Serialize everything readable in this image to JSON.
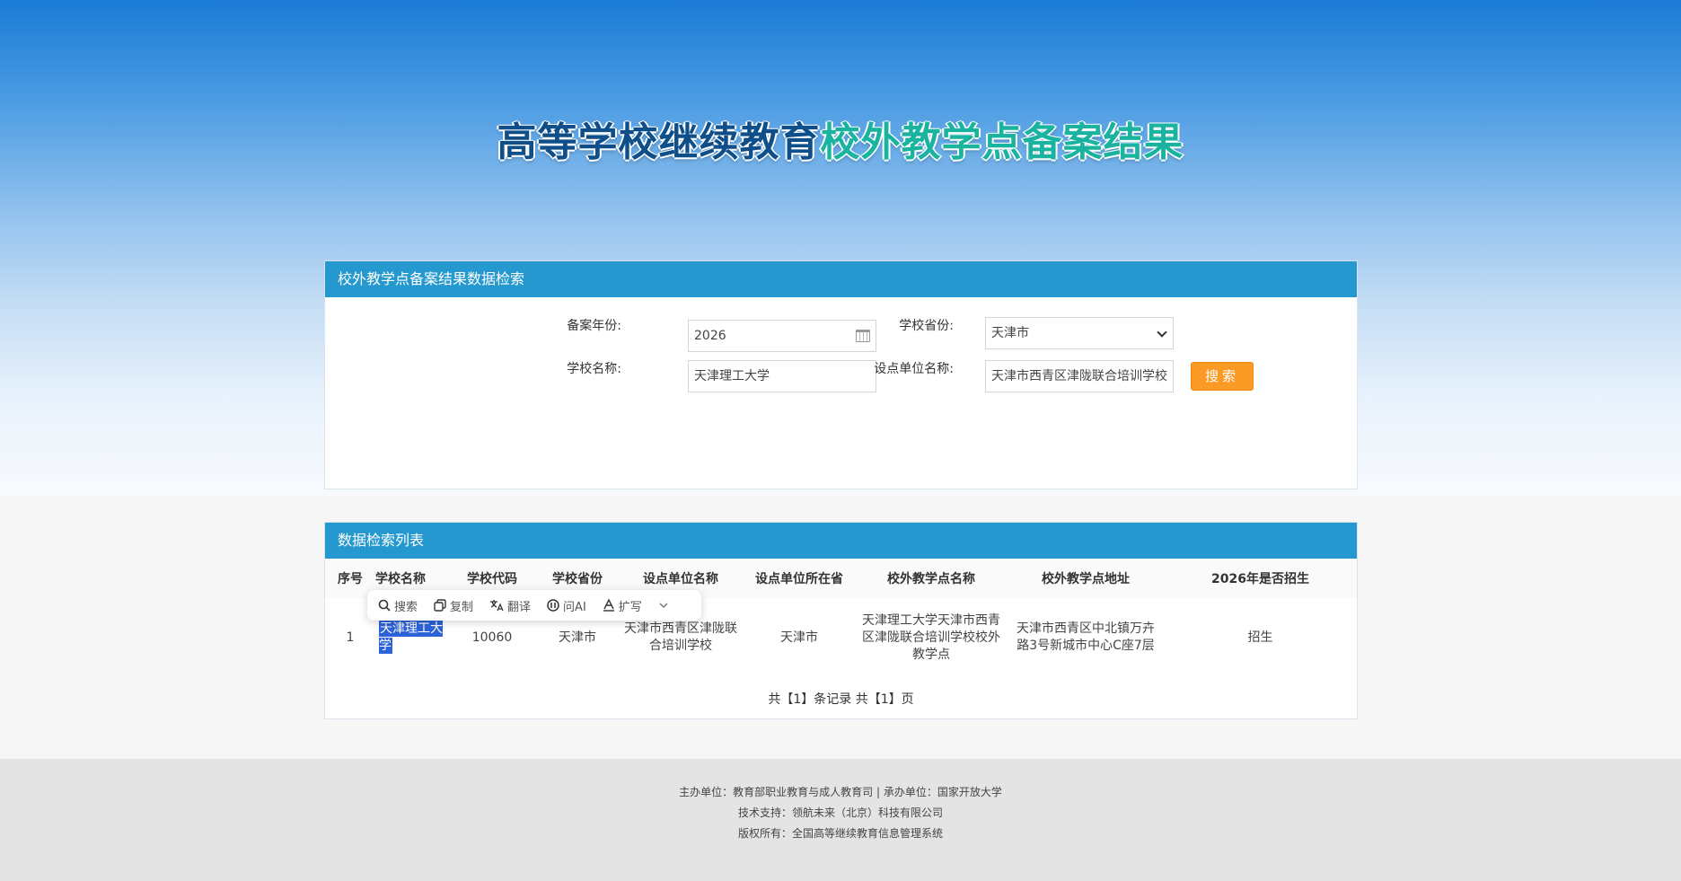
{
  "hero": {
    "title_part1": "高等学校继续教育",
    "title_part2": "校外教学点备案结果"
  },
  "search_panel": {
    "header": "校外教学点备案结果数据检索",
    "year_label": "备案年份:",
    "year_value": "2026",
    "province_label": "学校省份:",
    "province_value": "天津市",
    "school_label": "学校名称:",
    "school_value": "天津理工大学",
    "unit_label": "设点单位名称:",
    "unit_value": "天津市西青区津陇联合培训学校",
    "search_button": "搜索"
  },
  "list_panel": {
    "header": "数据检索列表",
    "columns": [
      "序号",
      "学校名称",
      "学校代码",
      "学校省份",
      "设点单位名称",
      "设点单位所在省",
      "校外教学点名称",
      "校外教学点地址",
      "2026年是否招生"
    ],
    "rows": [
      [
        "1",
        "天津理工大学",
        "10060",
        "天津市",
        "天津市西青区津陇联合培训学校",
        "天津市",
        "天津理工大学天津市西青区津陇联合培训学校校外教学点",
        "天津市西青区中北镇万卉路3号新城市中心C座7层",
        "招生"
      ]
    ],
    "pager": "共【1】条记录 共【1】页"
  },
  "floating_toolbar": {
    "items": [
      {
        "icon": "search-icon",
        "label": "搜索"
      },
      {
        "icon": "copy-icon",
        "label": "复制"
      },
      {
        "icon": "translate-icon",
        "label": "翻译"
      },
      {
        "icon": "ai-icon",
        "label": "问AI"
      },
      {
        "icon": "expand-write-icon",
        "label": "扩写"
      }
    ]
  },
  "footer": {
    "line1": "主办单位：教育部职业教育与成人教育司 | 承办单位：国家开放大学",
    "line2": "技术支持：领航未来（北京）科技有限公司",
    "line3": "版权所有：全国高等继续教育信息管理系统"
  },
  "colors": {
    "header_bar": "#2599cf",
    "search_button": "#fb9a25",
    "title_dark": "#0e4f8a",
    "title_teal": "#19b3a0",
    "selection": "#2c63d8"
  }
}
